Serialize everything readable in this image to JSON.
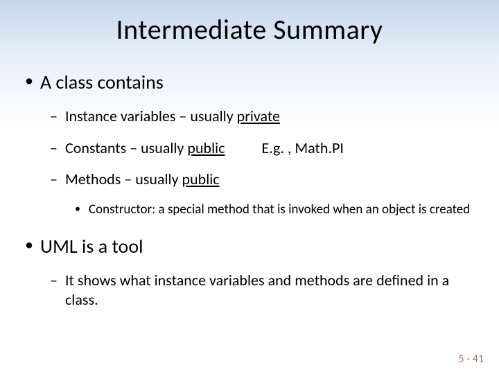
{
  "title": "Intermediate Summary",
  "bullets": {
    "b1": "A class contains",
    "b1a_pre": "Instance variables – usually ",
    "b1a_u": "private",
    "b1b_pre": "Constants – usually ",
    "b1b_u": "public",
    "b1b_ex": "E.g. , Math.PI",
    "b1c_pre": "Methods – usually ",
    "b1c_u": "public",
    "b1c_i": "Constructor: a special method that is invoked when an object is created",
    "b2": "UML is a tool",
    "b2a": "It shows what instance variables and methods are defined in a class."
  },
  "footer": "5 - 41"
}
